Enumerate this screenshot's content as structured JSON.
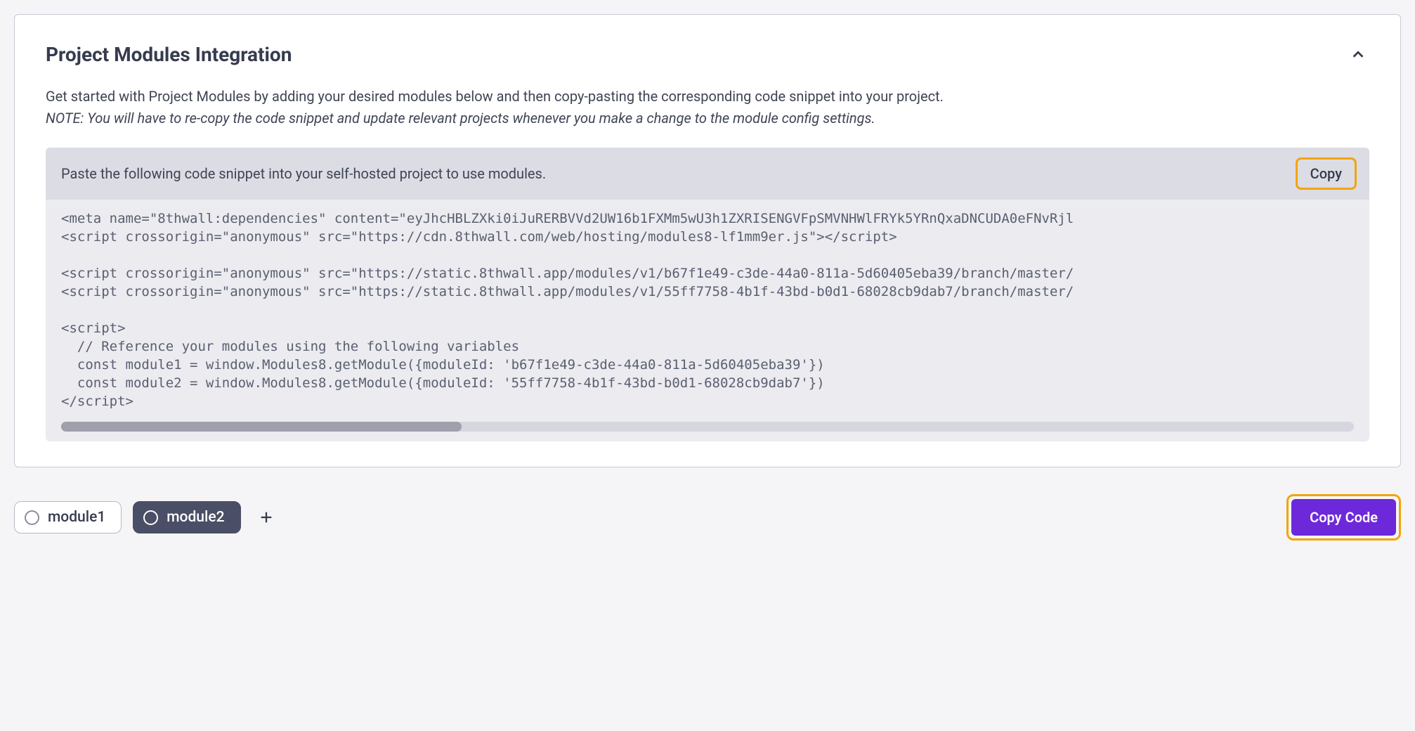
{
  "panel": {
    "title": "Project Modules Integration",
    "description": "Get started with Project Modules by adding your desired modules below and then copy-pasting the corresponding code snippet into your project.",
    "note": "NOTE: You will have to re-copy the code snippet and update relevant projects whenever you make a change to the module config settings."
  },
  "snippet": {
    "header_text": "Paste the following code snippet into your self-hosted project to use modules.",
    "copy_label": "Copy",
    "code": "<meta name=\"8thwall:dependencies\" content=\"eyJhcHBLZXki0iJuRERBVVd2UW16b1FXMm5wU3h1ZXRISENGVFpSMVNHWlFRYk5YRnQxaDNCUDA0eFNvRjl\n<script crossorigin=\"anonymous\" src=\"https://cdn.8thwall.com/web/hosting/modules8-lf1mm9er.js\"></script>\n\n<script crossorigin=\"anonymous\" src=\"https://static.8thwall.app/modules/v1/b67f1e49-c3de-44a0-811a-5d60405eba39/branch/master/\n<script crossorigin=\"anonymous\" src=\"https://static.8thwall.app/modules/v1/55ff7758-4b1f-43bd-b0d1-68028cb9dab7/branch/master/\n\n<script>\n  // Reference your modules using the following variables\n  const module1 = window.Modules8.getModule({moduleId: 'b67f1e49-c3de-44a0-811a-5d60405eba39'})\n  const module2 = window.Modules8.getModule({moduleId: '55ff7758-4b1f-43bd-b0d1-68028cb9dab7'})\n</script>"
  },
  "modules": {
    "items": [
      {
        "label": "module1",
        "active": false
      },
      {
        "label": "module2",
        "active": true
      }
    ]
  },
  "footer": {
    "copy_code_label": "Copy Code"
  }
}
